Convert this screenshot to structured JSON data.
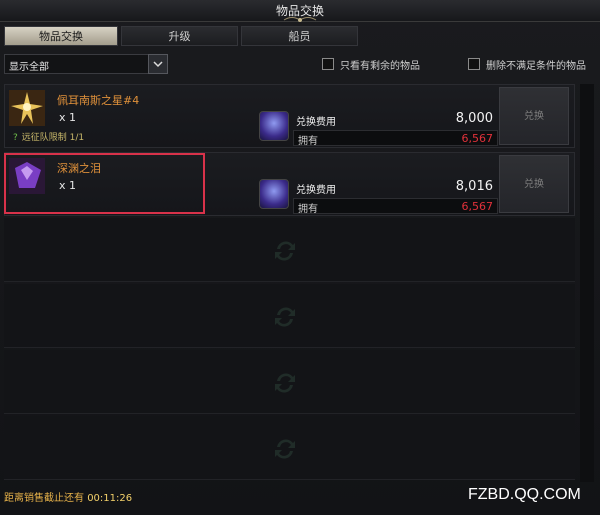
{
  "window": {
    "title": "物品交换"
  },
  "tabs": [
    {
      "label": "物品交换",
      "active": true
    },
    {
      "label": "升级",
      "active": false
    },
    {
      "label": "船员",
      "active": false
    }
  ],
  "filter": {
    "select_value": "显示全部",
    "checkbox1_label": "只看有剩余的物品",
    "checkbox2_label": "删除不满足条件的物品"
  },
  "items": [
    {
      "name": "佩耳南斯之星#4",
      "qty": "x 1",
      "note_mark": "?",
      "note": "远征队限制 1/1",
      "cost_label": "兑换费用",
      "cost_value": "8,000",
      "own_label": "拥有",
      "own_value": "6,567",
      "button": "兑换",
      "icon": "golden-star-icon"
    },
    {
      "name": "深渊之泪",
      "qty": "x 1",
      "cost_label": "兑换费用",
      "cost_value": "8,016",
      "own_label": "拥有",
      "own_value": "6,567",
      "button": "兑换",
      "icon": "purple-gem-icon"
    }
  ],
  "footer": {
    "label": "距离销售截止还有",
    "time": "00:11:26"
  },
  "watermark": "FZBD.QQ.COM",
  "colors": {
    "accent_orange": "#e0913a",
    "shortfall_red": "#e0313a",
    "highlight_red": "#d8324a",
    "active_tab": "#c7c1ae"
  }
}
